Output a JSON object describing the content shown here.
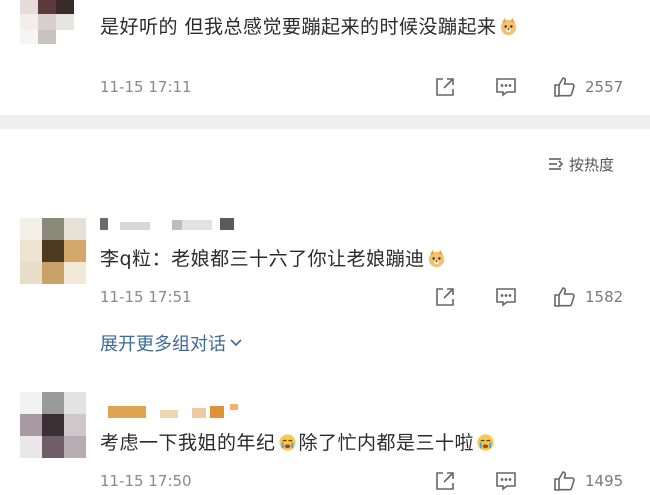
{
  "comments": [
    {
      "text": "是好听的 但我总感觉要蹦起来的时候没蹦起来",
      "emoji": "dog-face-emoji",
      "time": "11-15 17:11",
      "likes": "2557"
    },
    {
      "author": "李q粒",
      "text": "：老娘都三十六了你让老娘蹦迪",
      "emoji": "dog-face-emoji",
      "time": "11-15 17:51",
      "likes": "1582",
      "expand_label": "展开更多组对话"
    },
    {
      "text_part1": "考虑一下我姐的年纪",
      "text_part2": "除了忙内都是三十啦",
      "emoji": "crying-face-emoji",
      "time": "11-15 17:50",
      "likes": "1495"
    }
  ],
  "sort_label": "按热度",
  "colors": {
    "link": "#3d6a9a",
    "meta": "#8a8a8a",
    "divider": "#efefef"
  }
}
